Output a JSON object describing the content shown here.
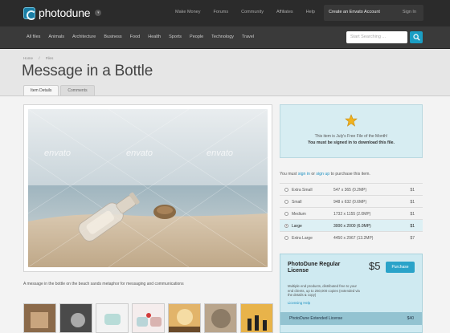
{
  "site": {
    "logo_text": "photodune",
    "top_nav": [
      "Make Money",
      "Forums",
      "Community",
      "Affiliates",
      "Help"
    ],
    "create_account": "Create an Envato Account",
    "sign_in": "Sign In"
  },
  "categories": [
    "All files",
    "Animals",
    "Architecture",
    "Business",
    "Food",
    "Health",
    "Sports",
    "People",
    "Technology",
    "Travel"
  ],
  "search": {
    "placeholder": "Start Searching ..."
  },
  "breadcrumb": [
    "Home",
    "Files"
  ],
  "page_title": "Message in a Bottle",
  "tabs": [
    {
      "label": "Item Details",
      "active": true
    },
    {
      "label": "Comments",
      "active": false
    }
  ],
  "image": {
    "watermark": "envato",
    "caption": "A message in the bottle on the beach sands metaphor for messaging and communications"
  },
  "notice": {
    "line1": "This item is July's Free File of the Month!",
    "line2": "You must be signed in to download this file."
  },
  "purchase_prompt": {
    "pre": "You must ",
    "sign_in": "sign in",
    "or": " or ",
    "sign_up": "sign up",
    "post": " to purchase this item."
  },
  "sizes": [
    {
      "name": "Extra Small",
      "dims": "547 x 365 (0.2MP)",
      "price": "$1",
      "selected": false
    },
    {
      "name": "Small",
      "dims": "948 x 632 (0.6MP)",
      "price": "$1",
      "selected": false
    },
    {
      "name": "Medium",
      "dims": "1732 x 1155 (2.0MP)",
      "price": "$1",
      "selected": false
    },
    {
      "name": "Large",
      "dims": "3000 x 2000 (6.0MP)",
      "price": "$1",
      "selected": true
    },
    {
      "name": "Extra Large",
      "dims": "4450 x 2967 (13.2MP)",
      "price": "$7",
      "selected": false
    }
  ],
  "license": {
    "name": "PhotoDune Regular License",
    "price": "$5",
    "purchase": "Purchase",
    "description": "Multiple end products, distributed free to your end clients, up to 250,000 copies (extended via the details & copy)",
    "help": "Licensing Help",
    "extended_name": "PhotoDune Extended License",
    "extended_price": "$40"
  }
}
